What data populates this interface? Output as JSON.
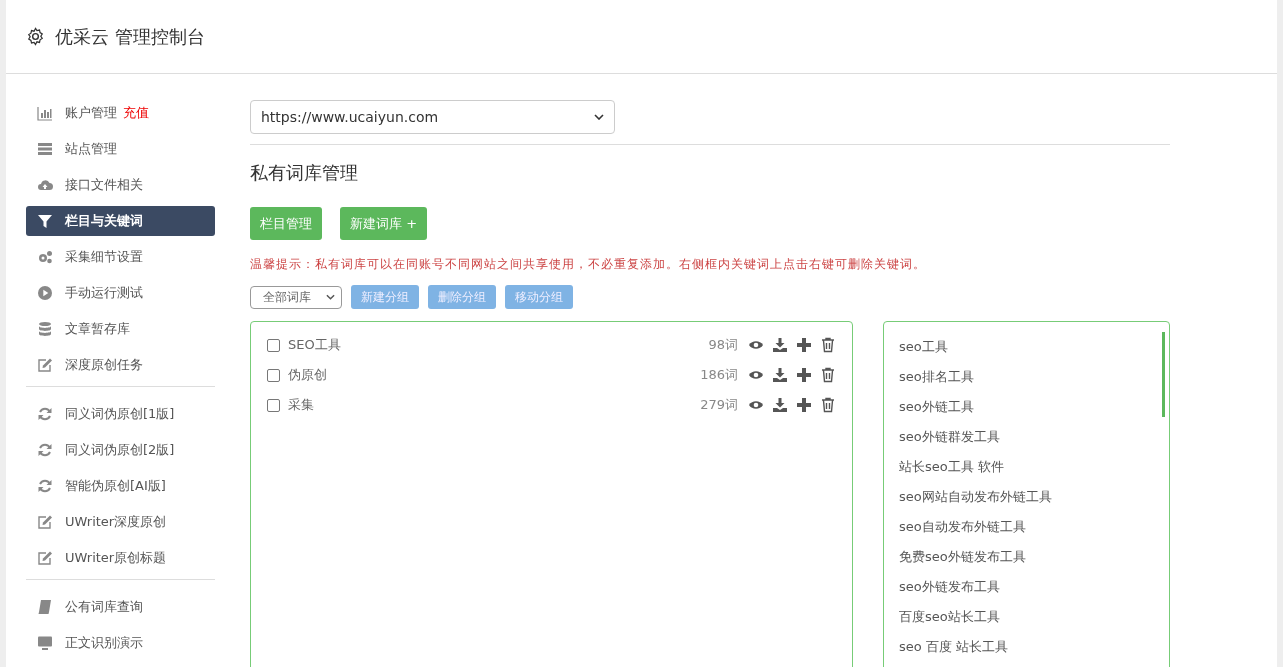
{
  "header": {
    "title": "优采云 管理控制台"
  },
  "sidebar": {
    "groups": [
      {
        "items": [
          {
            "label": "账户管理",
            "badge": "充值",
            "kind": "chart",
            "selected": false
          },
          {
            "label": "站点管理",
            "kind": "server",
            "selected": false
          },
          {
            "label": "接口文件相关",
            "kind": "cloud",
            "selected": false
          },
          {
            "label": "栏目与关键词",
            "kind": "filter",
            "selected": true
          },
          {
            "label": "采集细节设置",
            "kind": "gears",
            "selected": false
          },
          {
            "label": "手动运行测试",
            "kind": "play",
            "selected": false
          },
          {
            "label": "文章暂存库",
            "kind": "database",
            "selected": false
          },
          {
            "label": "深度原创任务",
            "kind": "edit",
            "selected": false
          }
        ]
      },
      {
        "items": [
          {
            "label": "同义词伪原创[1版]",
            "kind": "refresh",
            "selected": false
          },
          {
            "label": "同义词伪原创[2版]",
            "kind": "refresh",
            "selected": false
          },
          {
            "label": "智能伪原创[AI版]",
            "kind": "refresh",
            "selected": false
          },
          {
            "label": "UWriter深度原创",
            "kind": "edit",
            "selected": false
          },
          {
            "label": "UWriter原创标题",
            "kind": "edit",
            "selected": false
          }
        ]
      },
      {
        "items": [
          {
            "label": "公有词库查询",
            "kind": "book",
            "selected": false
          },
          {
            "label": "正文识别演示",
            "kind": "monitor",
            "selected": false
          }
        ]
      }
    ]
  },
  "site_select": {
    "value": "https://www.ucaiyun.com"
  },
  "section_title": "私有词库管理",
  "action_buttons": [
    "栏目管理",
    "新建词库 +"
  ],
  "tip": "温馨提示：私有词库可以在同账号不同网站之间共享使用，不必重复添加。右侧框内关键词上点击右键可删除关键词。",
  "group_select": {
    "value": "全部词库"
  },
  "group_buttons": [
    "新建分组",
    "删除分组",
    "移动分组"
  ],
  "libraries": [
    {
      "name": "SEO工具",
      "count": "98词",
      "checked": false
    },
    {
      "name": "伪原创",
      "count": "186词",
      "checked": false
    },
    {
      "name": "采集",
      "count": "279词",
      "checked": false
    }
  ],
  "keywords": [
    "seo工具",
    "seo排名工具",
    "seo外链工具",
    "seo外链群发工具",
    "站长seo工具 软件",
    "seo网站自动发布外链工具",
    "seo自动发布外链工具",
    "免费seo外链发布工具",
    "seo外链发布工具",
    "百度seo站长工具",
    "seo 百度 站长工具"
  ]
}
